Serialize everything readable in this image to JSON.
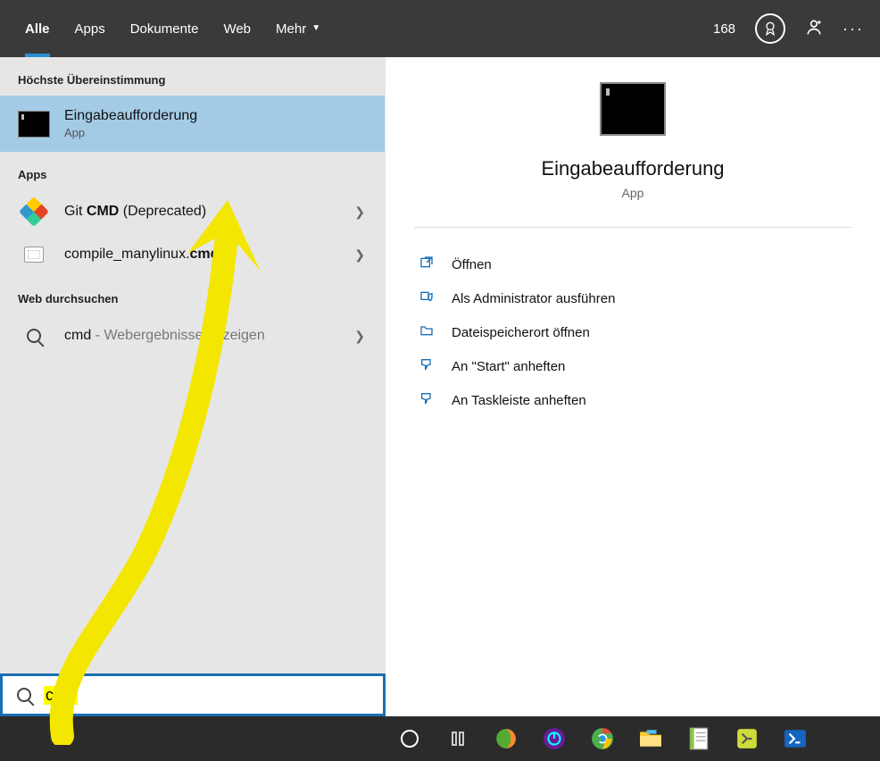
{
  "tabs": {
    "all": "Alle",
    "apps": "Apps",
    "documents": "Dokumente",
    "web": "Web",
    "more": "Mehr"
  },
  "points": "168",
  "sections": {
    "best": "Höchste Übereinstimmung",
    "apps": "Apps",
    "web": "Web durchsuchen"
  },
  "best_match": {
    "title": "Eingabeaufforderung",
    "subtitle": "App"
  },
  "app_results": [
    {
      "prefix": "Git ",
      "bold": "CMD",
      "suffix": " (Deprecated)"
    },
    {
      "prefix": "compile_manylinux.",
      "bold": "cmd",
      "suffix": ""
    }
  ],
  "web_result": {
    "query": "cmd",
    "suffix": " - Webergebnisse anzeigen"
  },
  "details": {
    "title": "Eingabeaufforderung",
    "subtitle": "App",
    "actions": [
      "Öffnen",
      "Als Administrator ausführen",
      "Dateispeicherort öffnen",
      "An \"Start\" anheften",
      "An Taskleiste anheften"
    ]
  },
  "search_value": "cmd"
}
